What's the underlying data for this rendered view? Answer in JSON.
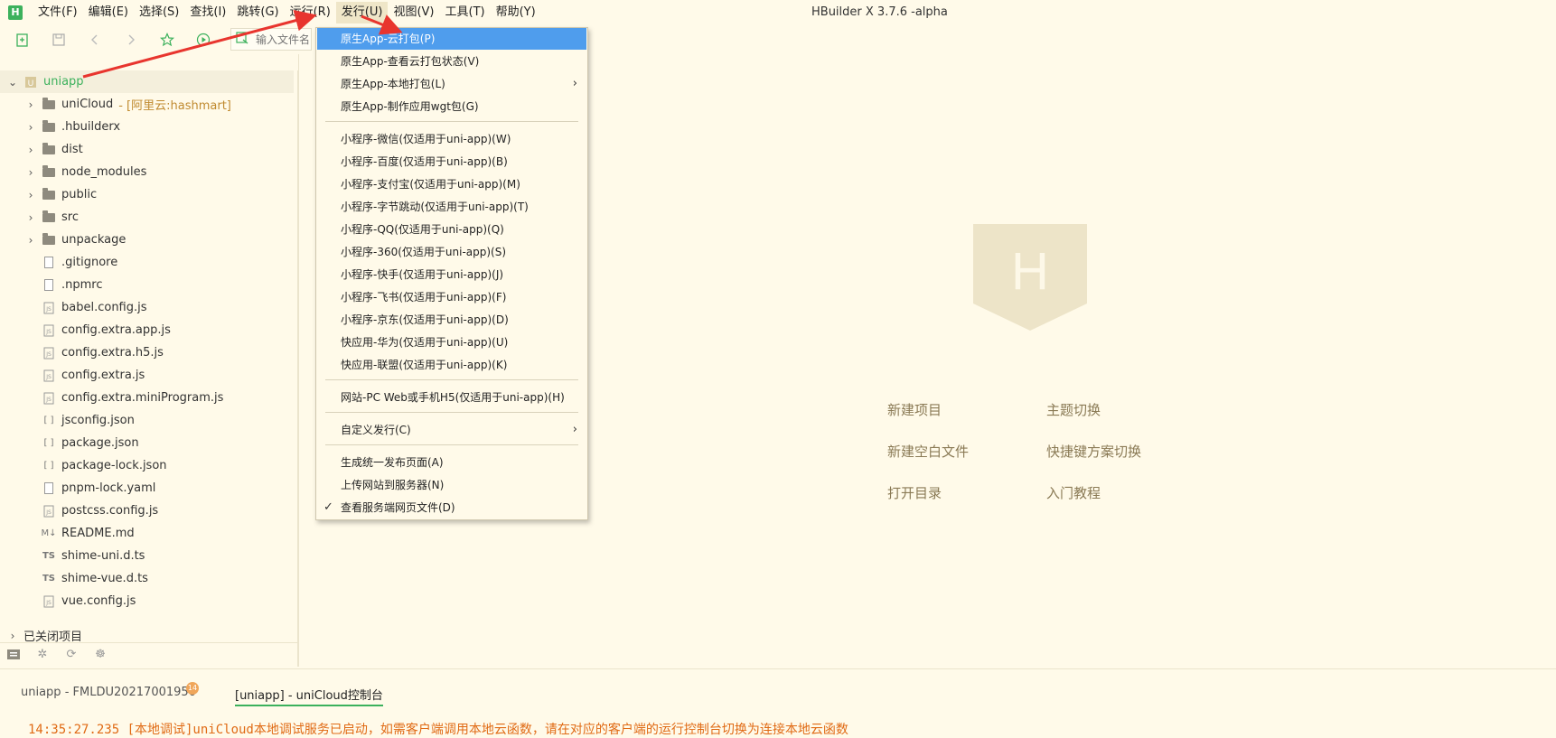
{
  "window": {
    "title": "HBuilder X 3.7.6 -alpha",
    "app_icon_letter": "H"
  },
  "menubar": {
    "items": [
      {
        "label": "文件(F)"
      },
      {
        "label": "编辑(E)"
      },
      {
        "label": "选择(S)"
      },
      {
        "label": "查找(I)"
      },
      {
        "label": "跳转(G)"
      },
      {
        "label": "运行(R)"
      },
      {
        "label": "发行(U)"
      },
      {
        "label": "视图(V)"
      },
      {
        "label": "工具(T)"
      },
      {
        "label": "帮助(Y)"
      }
    ],
    "active_index": 6
  },
  "toolbar": {
    "search_placeholder": "输入文件名"
  },
  "sidebar": {
    "root": {
      "label": "uniapp"
    },
    "items": [
      {
        "label": "uniCloud",
        "tag": "- [阿里云:hashmart]",
        "type": "cloud-folder"
      },
      {
        "label": ".hbuilderx",
        "type": "folder"
      },
      {
        "label": "dist",
        "type": "folder"
      },
      {
        "label": "node_modules",
        "type": "folder"
      },
      {
        "label": "public",
        "type": "folder"
      },
      {
        "label": "src",
        "type": "folder"
      },
      {
        "label": "unpackage",
        "type": "folder"
      },
      {
        "label": ".gitignore",
        "type": "file"
      },
      {
        "label": ".npmrc",
        "type": "file"
      },
      {
        "label": "babel.config.js",
        "type": "js"
      },
      {
        "label": "config.extra.app.js",
        "type": "js"
      },
      {
        "label": "config.extra.h5.js",
        "type": "js"
      },
      {
        "label": "config.extra.js",
        "type": "js"
      },
      {
        "label": "config.extra.miniProgram.js",
        "type": "js"
      },
      {
        "label": "jsconfig.json",
        "type": "json"
      },
      {
        "label": "package.json",
        "type": "json"
      },
      {
        "label": "package-lock.json",
        "type": "json"
      },
      {
        "label": "pnpm-lock.yaml",
        "type": "file"
      },
      {
        "label": "postcss.config.js",
        "type": "js"
      },
      {
        "label": "README.md",
        "type": "md"
      },
      {
        "label": "shime-uni.d.ts",
        "type": "ts"
      },
      {
        "label": "shime-vue.d.ts",
        "type": "ts"
      },
      {
        "label": "vue.config.js",
        "type": "js"
      }
    ],
    "closed_projects": "已关闭项目"
  },
  "dropdown": {
    "items": [
      {
        "label": "原生App-云打包(P)",
        "highlight": true
      },
      {
        "label": "原生App-查看云打包状态(V)"
      },
      {
        "label": "原生App-本地打包(L)",
        "submenu": true
      },
      {
        "label": "原生App-制作应用wgt包(G)"
      },
      {
        "label": "小程序-微信(仅适用于uni-app)(W)"
      },
      {
        "label": "小程序-百度(仅适用于uni-app)(B)"
      },
      {
        "label": "小程序-支付宝(仅适用于uni-app)(M)"
      },
      {
        "label": "小程序-字节跳动(仅适用于uni-app)(T)"
      },
      {
        "label": "小程序-QQ(仅适用于uni-app)(Q)"
      },
      {
        "label": "小程序-360(仅适用于uni-app)(S)"
      },
      {
        "label": "小程序-快手(仅适用于uni-app)(J)"
      },
      {
        "label": "小程序-飞书(仅适用于uni-app)(F)"
      },
      {
        "label": "小程序-京东(仅适用于uni-app)(D)"
      },
      {
        "label": "快应用-华为(仅适用于uni-app)(U)"
      },
      {
        "label": "快应用-联盟(仅适用于uni-app)(K)"
      },
      {
        "label": "网站-PC Web或手机H5(仅适用于uni-app)(H)"
      },
      {
        "label": "自定义发行(C)",
        "submenu": true
      },
      {
        "label": "生成统一发布页面(A)"
      },
      {
        "label": "上传网站到服务器(N)"
      },
      {
        "label": "查看服务端网页文件(D)",
        "checked": true
      }
    ]
  },
  "welcome": {
    "links": [
      {
        "label": "新建项目"
      },
      {
        "label": "主题切换"
      },
      {
        "label": "新建空白文件"
      },
      {
        "label": "快捷键方案切换"
      },
      {
        "label": "打开目录"
      },
      {
        "label": "入门教程"
      }
    ]
  },
  "console": {
    "tab1": "uniapp - FMLDU20217001950",
    "badge": "14",
    "tab2": "[uniapp] - uniCloud控制台",
    "log": "14:35:27.235 [本地调试]uniCloud本地调试服务已启动，如需客户端调用本地云函数，请在对应的客户端的运行控制台切换为连接本地云函数"
  },
  "colors": {
    "accent_green": "#3cb15c",
    "highlight_blue": "#4f9ded",
    "arrow_red": "#e8352e",
    "log_orange": "#e06a14"
  }
}
